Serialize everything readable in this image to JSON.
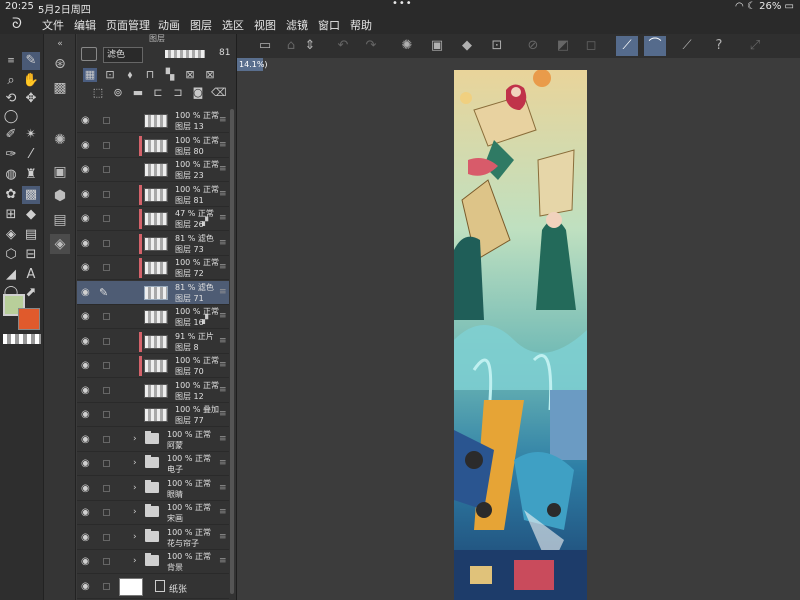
{
  "status": {
    "time": "20:25",
    "date": "5月2日周四",
    "battery": "26%"
  },
  "menu": [
    "文件",
    "编辑",
    "页面管理",
    "动画",
    "图层",
    "选区",
    "视图",
    "滤镜",
    "窗口",
    "帮助"
  ],
  "document_tab": "14.1%)",
  "layer_panel": {
    "title": "图层",
    "blend_mode": "滤色",
    "opacity": "81",
    "layers": [
      {
        "type": "layer",
        "line1": "100 % 正常",
        "name": "图层 13",
        "mark": false
      },
      {
        "type": "layer",
        "line1": "100 % 正常",
        "name": "图层 80",
        "mark": true
      },
      {
        "type": "layer",
        "line1": "100 % 正常",
        "name": "图层 23",
        "mark": false
      },
      {
        "type": "layer",
        "line1": "100 % 正常",
        "name": "图层 81",
        "mark": true
      },
      {
        "type": "layer",
        "line1": "47 % 正常",
        "name": "图层 26",
        "mark": true,
        "lock": true
      },
      {
        "type": "layer",
        "line1": "81 % 滤色",
        "name": "图层 73",
        "mark": true
      },
      {
        "type": "layer",
        "line1": "100 % 正常",
        "name": "图层 72",
        "mark": true
      },
      {
        "type": "layer",
        "line1": "81 % 滤色",
        "name": "图层 71",
        "mark": false,
        "selected": true
      },
      {
        "type": "layer",
        "line1": "100 % 正常",
        "name": "图层 16",
        "mark": false,
        "lock": true
      },
      {
        "type": "layer",
        "line1": "91 % 正片",
        "name": "图层 8",
        "mark": true
      },
      {
        "type": "layer",
        "line1": "100 % 正常",
        "name": "图层 70",
        "mark": true
      },
      {
        "type": "layer",
        "line1": "100 % 正常",
        "name": "图层 12",
        "mark": false
      },
      {
        "type": "layer",
        "line1": "100 % 叠加",
        "name": "图层 77",
        "mark": false
      },
      {
        "type": "folder",
        "line1": "100 % 正常",
        "name": "阿蒙"
      },
      {
        "type": "folder",
        "line1": "100 % 正常",
        "name": "电子"
      },
      {
        "type": "folder",
        "line1": "100 % 正常",
        "name": "眼睛"
      },
      {
        "type": "folder",
        "line1": "100 % 正常",
        "name": "宋画"
      },
      {
        "type": "folder",
        "line1": "100 % 正常",
        "name": "花与帘子"
      },
      {
        "type": "folder",
        "line1": "100 % 正常",
        "name": "背景"
      },
      {
        "type": "paper",
        "name": "纸张"
      }
    ]
  },
  "colors": {
    "foreground": "#b8cf9a",
    "background": "#e05a2c",
    "accent": "#556b8c"
  }
}
